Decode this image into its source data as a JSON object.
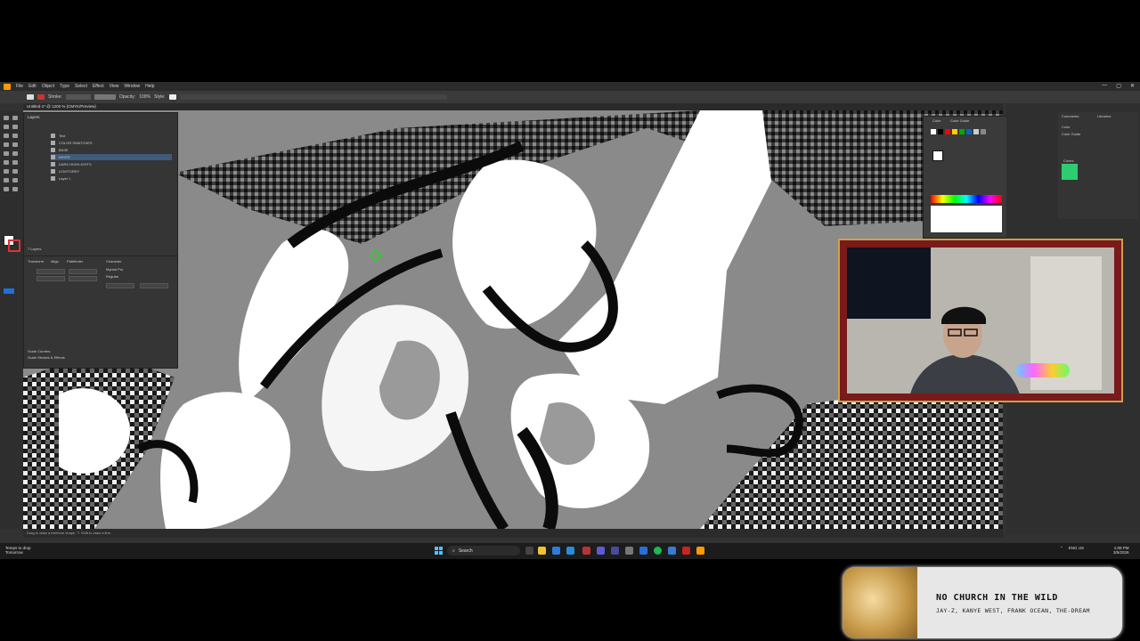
{
  "app": {
    "menu": [
      "File",
      "Edit",
      "Object",
      "Type",
      "Select",
      "Effect",
      "View",
      "Window",
      "Help"
    ],
    "control_bar": {
      "stroke_label": "Stroke:",
      "opacity_label": "Opacity:",
      "opacity_value": "100%",
      "style_label": "Style:"
    },
    "document_tab": "Untitled-1* @ 1200 % (CMYK/Preview)",
    "status_bar": "Drag to draw a freeform shape. ⇧ Shift to draw a line."
  },
  "layers_panel": {
    "title": "Layers",
    "layers": [
      "Text",
      "COLOR SWATCHES",
      "BASE",
      "WHITE",
      "DARK HIGHLIGHTS",
      "LIGHTGREY",
      "Layer 1"
    ],
    "selected_index": 3,
    "footer": "7 Layers"
  },
  "properties_panel": {
    "tabs": [
      "Transform",
      "Align",
      "Pathfinder"
    ],
    "character_tab": "Character",
    "font_name": "Myriad Pro",
    "font_style": "Regular",
    "options": [
      "Scale Corners",
      "Scale Strokes & Effects"
    ]
  },
  "swatches_panel": {
    "tabs": [
      "Color",
      "Color Guide"
    ],
    "swatch_colors": [
      "#ffffff",
      "#000000",
      "#ff0000",
      "#ffcc00",
      "#00aa00",
      "#0066cc",
      "#cccccc",
      "#888888"
    ]
  },
  "library_panel": {
    "tabs": [
      "Comments",
      "Libraries"
    ],
    "items": [
      "Color",
      "Color Guide"
    ],
    "section": "Colors",
    "swatch_color": "#2ecc71"
  },
  "taskbar": {
    "weather_line1": "Temps to drop",
    "weather_line2": "Tomorrow",
    "search_placeholder": "Search",
    "tray_lang_line1": "ENG",
    "tray_lang_line2": "US",
    "clock_time": "1:08 PM",
    "clock_date": "3/5/2026"
  },
  "now_playing": {
    "title": "NO CHURCH IN THE WILD",
    "artist": "JAY-Z, KANYE WEST, FRANK OCEAN, THE-DREAM"
  }
}
